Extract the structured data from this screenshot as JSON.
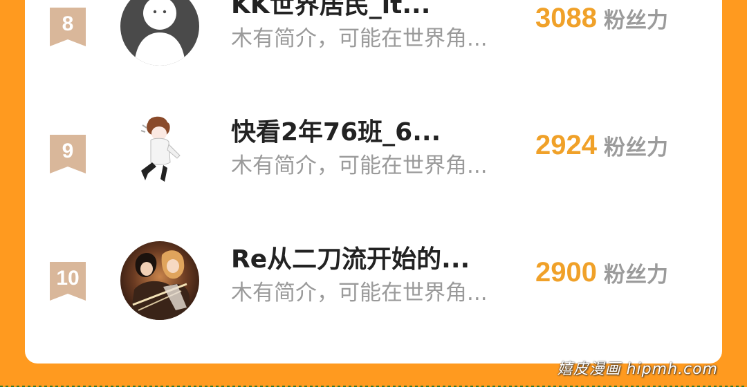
{
  "ranking": [
    {
      "rank": "8",
      "name": "KK世界居民_lt...",
      "bio": "木有简介，可能在世界角...",
      "fans": "3088",
      "fans_label": "粉丝力",
      "avatar": "default-silhouette-avatar"
    },
    {
      "rank": "9",
      "name": "快看2年76班_6...",
      "bio": "木有简介，可能在世界角...",
      "fans": "2924",
      "fans_label": "粉丝力",
      "avatar": "sketch-character-avatar"
    },
    {
      "rank": "10",
      "name": "Re从二刀流开始的...",
      "bio": "木有简介，可能在世界角...",
      "fans": "2900",
      "fans_label": "粉丝力",
      "avatar": "anime-swordsmen-avatar"
    }
  ],
  "watermark": "嬉皮漫画 hipmh.com",
  "colors": {
    "frame": "#ff9a1f",
    "rank_badge": "#d9b79a",
    "fans_number": "#f0a129",
    "name": "#222222",
    "bio": "#9a9a9a"
  }
}
